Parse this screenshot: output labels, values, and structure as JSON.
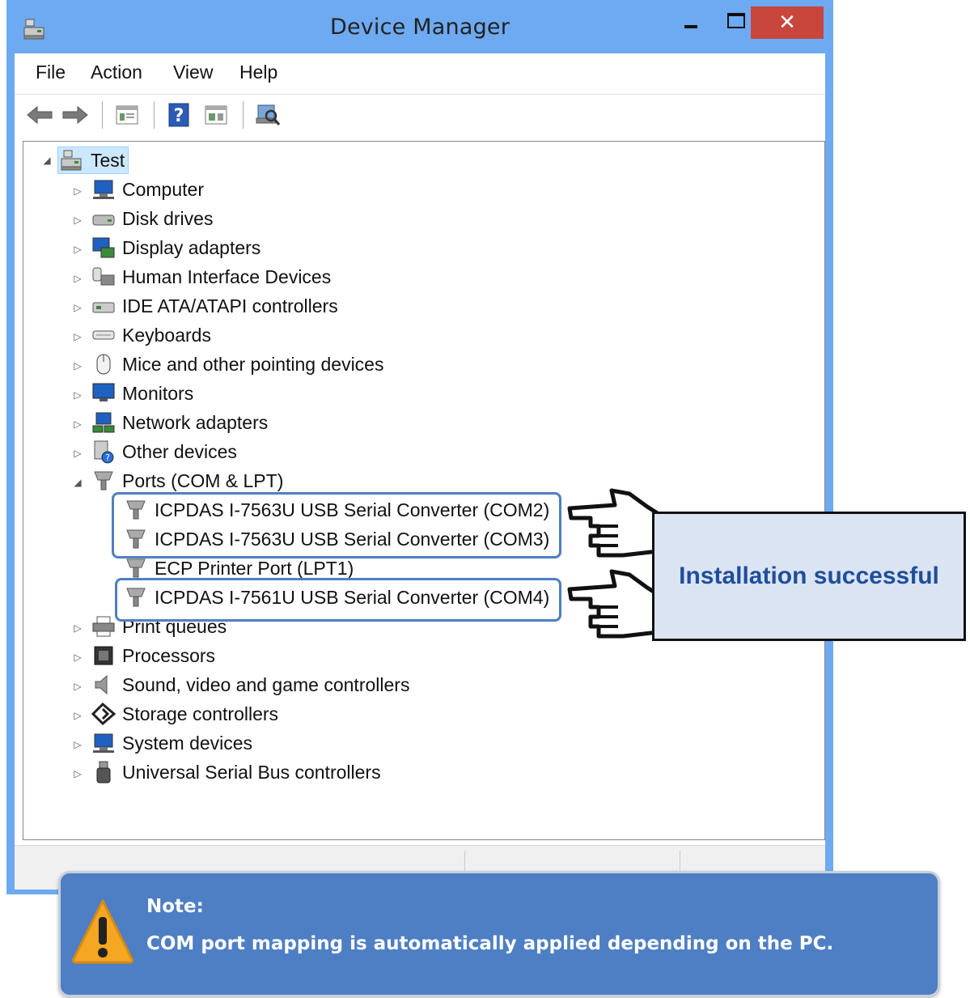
{
  "window": {
    "title": "Device Manager"
  },
  "menu": [
    "File",
    "Action",
    "View",
    "Help"
  ],
  "toolbar": [
    "back-icon",
    "forward-icon",
    "properties-icon",
    "help-icon",
    "update-driver-icon",
    "scan-hardware-icon"
  ],
  "tree": {
    "root": "Test",
    "categories": [
      {
        "label": "Computer",
        "icon": "computer-icon"
      },
      {
        "label": "Disk drives",
        "icon": "disk-drive-icon"
      },
      {
        "label": "Display adapters",
        "icon": "display-adapter-icon"
      },
      {
        "label": "Human Interface Devices",
        "icon": "hid-icon"
      },
      {
        "label": "IDE ATA/ATAPI controllers",
        "icon": "ide-controller-icon"
      },
      {
        "label": "Keyboards",
        "icon": "keyboard-icon"
      },
      {
        "label": "Mice and other pointing devices",
        "icon": "mouse-icon"
      },
      {
        "label": "Monitors",
        "icon": "monitor-icon"
      },
      {
        "label": "Network adapters",
        "icon": "network-adapter-icon"
      },
      {
        "label": "Other devices",
        "icon": "other-devices-icon"
      },
      {
        "label": "Ports (COM & LPT)",
        "icon": "port-icon"
      },
      {
        "label": "Print queues",
        "icon": "printer-icon"
      },
      {
        "label": "Processors",
        "icon": "processor-icon"
      },
      {
        "label": "Sound, video and game controllers",
        "icon": "speaker-icon"
      },
      {
        "label": "Storage controllers",
        "icon": "storage-icon"
      },
      {
        "label": "System devices",
        "icon": "system-devices-icon"
      },
      {
        "label": "Universal Serial Bus controllers",
        "icon": "usb-icon"
      }
    ],
    "ports": [
      "ICPDAS I-7563U USB Serial Converter (COM2)",
      "ICPDAS I-7563U USB Serial Converter (COM3)",
      "ECP Printer Port (LPT1)",
      "ICPDAS I-7561U USB Serial Converter (COM4)"
    ]
  },
  "callout": {
    "text": "Installation successful"
  },
  "note": {
    "title": "Note:",
    "text": "COM port mapping is automatically applied depending on the PC."
  },
  "colors": {
    "titlebar": "#6eaaf1",
    "close": "#c9463c",
    "highlight": "#4f7fc2",
    "note_bg": "#4e7fc4",
    "callout_bg": "#dbe4f2",
    "callout_text": "#1f4e9a"
  }
}
